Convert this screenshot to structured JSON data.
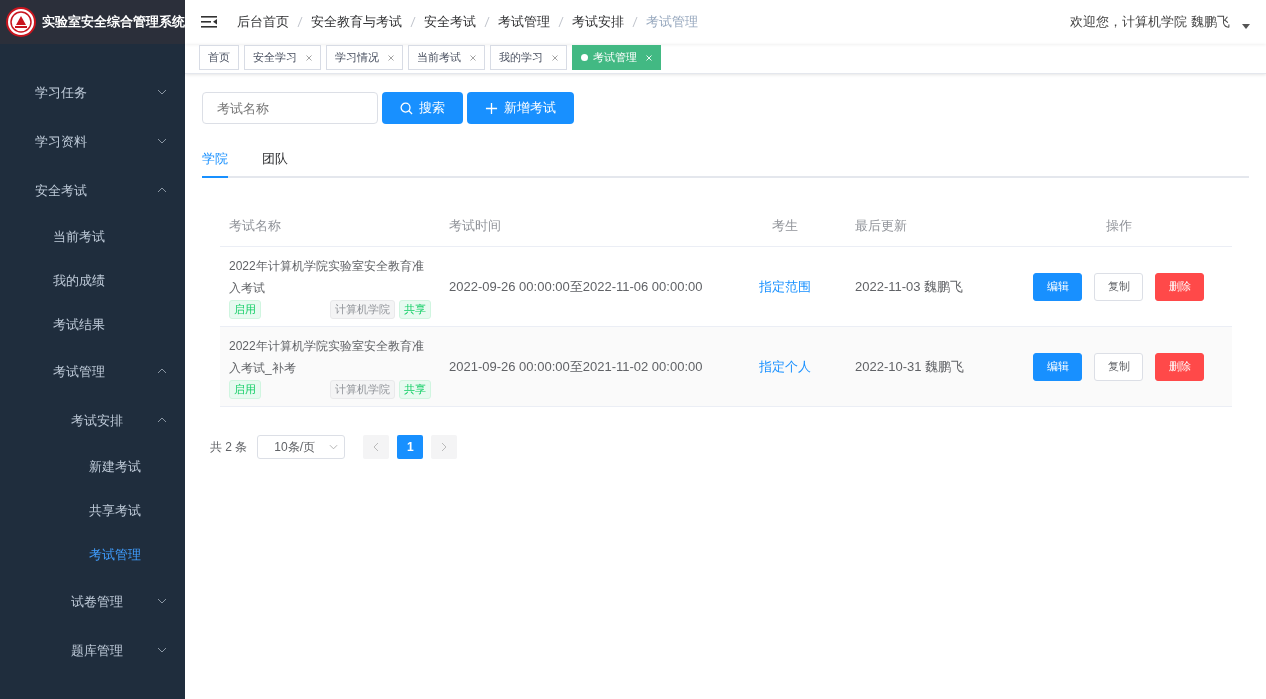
{
  "app": {
    "title": "实验室安全综合管理系统"
  },
  "sidebar": {
    "items": [
      {
        "label": "学习任务",
        "expanded": false,
        "selected": false
      },
      {
        "label": "学习资料",
        "expanded": false,
        "selected": false
      },
      {
        "label": "安全考试",
        "expanded": true,
        "selected": false,
        "children": [
          {
            "label": "当前考试",
            "selected": false
          },
          {
            "label": "我的成绩",
            "selected": false
          },
          {
            "label": "考试结果",
            "selected": false
          },
          {
            "label": "考试管理",
            "expanded": true,
            "selected": false,
            "children": [
              {
                "label": "考试安排",
                "expanded": true,
                "selected": false,
                "children": [
                  {
                    "label": "新建考试",
                    "selected": false
                  },
                  {
                    "label": "共享考试",
                    "selected": false
                  },
                  {
                    "label": "考试管理",
                    "selected": true
                  }
                ]
              },
              {
                "label": "试卷管理",
                "expanded": false,
                "selected": false
              },
              {
                "label": "题库管理",
                "expanded": false,
                "selected": false
              }
            ]
          }
        ]
      }
    ]
  },
  "breadcrumb": [
    "后台首页",
    "安全教育与考试",
    "安全考试",
    "考试管理",
    "考试安排",
    "考试管理"
  ],
  "user": "欢迎您，计算机学院 魏鹏飞",
  "tags": [
    {
      "label": "首页",
      "closable": false,
      "selected": false
    },
    {
      "label": "安全学习",
      "closable": true,
      "selected": false
    },
    {
      "label": "学习情况",
      "closable": true,
      "selected": false
    },
    {
      "label": "当前考试",
      "closable": true,
      "selected": false
    },
    {
      "label": "我的学习",
      "closable": true,
      "selected": false
    },
    {
      "label": "考试管理",
      "closable": true,
      "selected": true
    }
  ],
  "search": {
    "placeholder": "考试名称",
    "search_button": "搜索",
    "add_button": "新增考试"
  },
  "tabs": [
    {
      "label": "学院",
      "selected": true
    },
    {
      "label": "团队",
      "selected": false
    }
  ],
  "table": {
    "columns": [
      "考试名称",
      "考试时间",
      "考生",
      "最后更新",
      "操作"
    ],
    "rows": [
      {
        "name": "2022年计算机学院实验室安全教育准入考试",
        "status": "启用",
        "college": "计算机学院",
        "shared": "共享",
        "time": "2022-09-26 00:00:00至2022-11-06 00:00:00",
        "examinee": "指定范围",
        "updated": "2022-11-03 魏鹏飞",
        "actions": [
          "编辑",
          "复制",
          "删除"
        ]
      },
      {
        "name": "2022年计算机学院实验室安全教育准入考试_补考",
        "status": "启用",
        "college": "计算机学院",
        "shared": "共享",
        "time": "2021-09-26 00:00:00至2021-11-02 00:00:00",
        "examinee": "指定个人",
        "updated": "2022-10-31 魏鹏飞",
        "actions": [
          "编辑",
          "复制",
          "删除"
        ]
      }
    ]
  },
  "pagination": {
    "total": "共 2 条",
    "page_size": "10条/页",
    "pages": [
      {
        "label": "1",
        "selected": true
      }
    ]
  }
}
